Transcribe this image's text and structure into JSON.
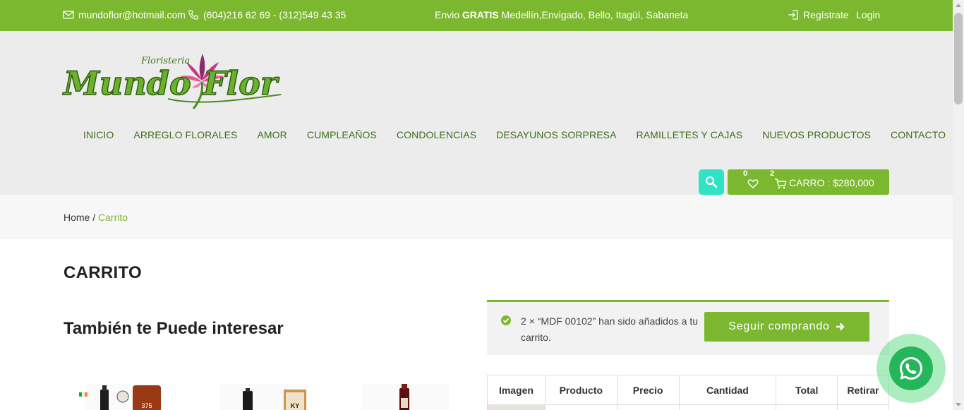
{
  "topbar": {
    "email": "mundoflor@hotmail.com",
    "phone": "(604)216 62 69 - (312)549 43 35",
    "shipping_prefix": "Envio ",
    "shipping_bold": "GRATIS",
    "shipping_suffix": " Medellín,Envigado, Bello, Itagüí, Sabaneta",
    "register_label": "Regístrate",
    "login_label": "Login"
  },
  "logo": {
    "small_text": "Floristeria",
    "main_text_left": "Mundo",
    "main_text_right": "Flor"
  },
  "nav": {
    "items": [
      {
        "label": "INICIO"
      },
      {
        "label": "ARREGLO FLORALES"
      },
      {
        "label": "AMOR"
      },
      {
        "label": "CUMPLEAÑOS"
      },
      {
        "label": "CONDOLENCIAS"
      },
      {
        "label": "DESAYUNOS SORPRESA"
      },
      {
        "label": "RAMILLETES Y CAJAS"
      },
      {
        "label": "NUEVOS PRODUCTOS"
      },
      {
        "label": "CONTACTO"
      }
    ]
  },
  "header_actions": {
    "wishlist_count": "0",
    "cart_count": "2",
    "cart_label": "CARRO : $280,000"
  },
  "breadcrumb": {
    "home": "Home",
    "separator": " / ",
    "current": "Carrito"
  },
  "page": {
    "title": "CARRITO",
    "related_title": "También te Puede interesar"
  },
  "products": [
    {
      "badge_text": "375"
    },
    {
      "badge_text": "KY"
    },
    {
      "badge_text": ""
    }
  ],
  "notice": {
    "message": "2 × “MDF 00102” han sido añadidos a tu carrito.",
    "button_label": "Seguir comprando"
  },
  "cart_table": {
    "headers": [
      "Imagen",
      "Producto",
      "Precio",
      "Cantidad",
      "Total",
      "Retirar"
    ]
  },
  "colors": {
    "brand_green": "#7cb82f",
    "nav_text": "#3d6d1d",
    "search_accent": "#2fe3c3",
    "whatsapp_green": "#25b65b"
  }
}
